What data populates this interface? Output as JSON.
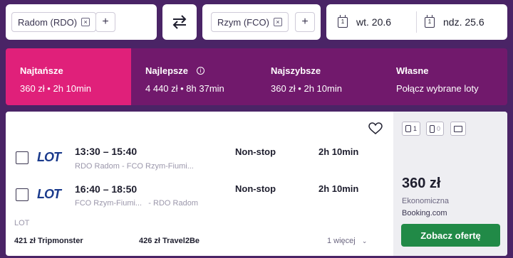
{
  "search": {
    "origin": "Radom (RDO)",
    "destination": "Rzym (FCO)",
    "add": "+",
    "remove": "×",
    "depart_icon_num": "1",
    "return_icon_num": "1",
    "depart_date": "wt. 20.6",
    "return_date": "ndz. 25.6"
  },
  "tabs": [
    {
      "title": "Najtańsze",
      "sub": "360 zł • 2h 10min"
    },
    {
      "title": "Najlepsze",
      "sub": "4 440 zł • 8h 37min",
      "info": "i"
    },
    {
      "title": "Najszybsze",
      "sub": "360 zł • 2h 10min"
    },
    {
      "title": "Własne",
      "sub": "Połącz wybrane loty"
    }
  ],
  "result": {
    "badges": {
      "cabin_bags": "1",
      "checked_bags": "0"
    },
    "flights": [
      {
        "airline_logo": "LOT",
        "time": "13:30 – 15:40",
        "from": "RDO Radom",
        "to": "FCO Rzym-Fiumi...",
        "stops": "Non-stop",
        "duration": "2h 10min"
      },
      {
        "airline_logo": "LOT",
        "time": "16:40 – 18:50",
        "from": "FCO Rzym-Fiumi...",
        "to": "RDO Radom",
        "stops": "Non-stop",
        "duration": "2h 10min"
      }
    ],
    "carrier": "LOT",
    "offers": [
      {
        "price": "421 zł",
        "provider": "Tripmonster"
      },
      {
        "price": "426 zł",
        "provider": "Travel2Be"
      }
    ],
    "more": "1 więcej",
    "price": "360 zł",
    "cabin": "Ekonomiczna",
    "seller": "Booking.com",
    "cta": "Zobacz ofertę"
  },
  "colors": {
    "active_tab": "#e0207a",
    "tab": "#71196c",
    "background": "#4a2466",
    "cta": "#218a47"
  }
}
